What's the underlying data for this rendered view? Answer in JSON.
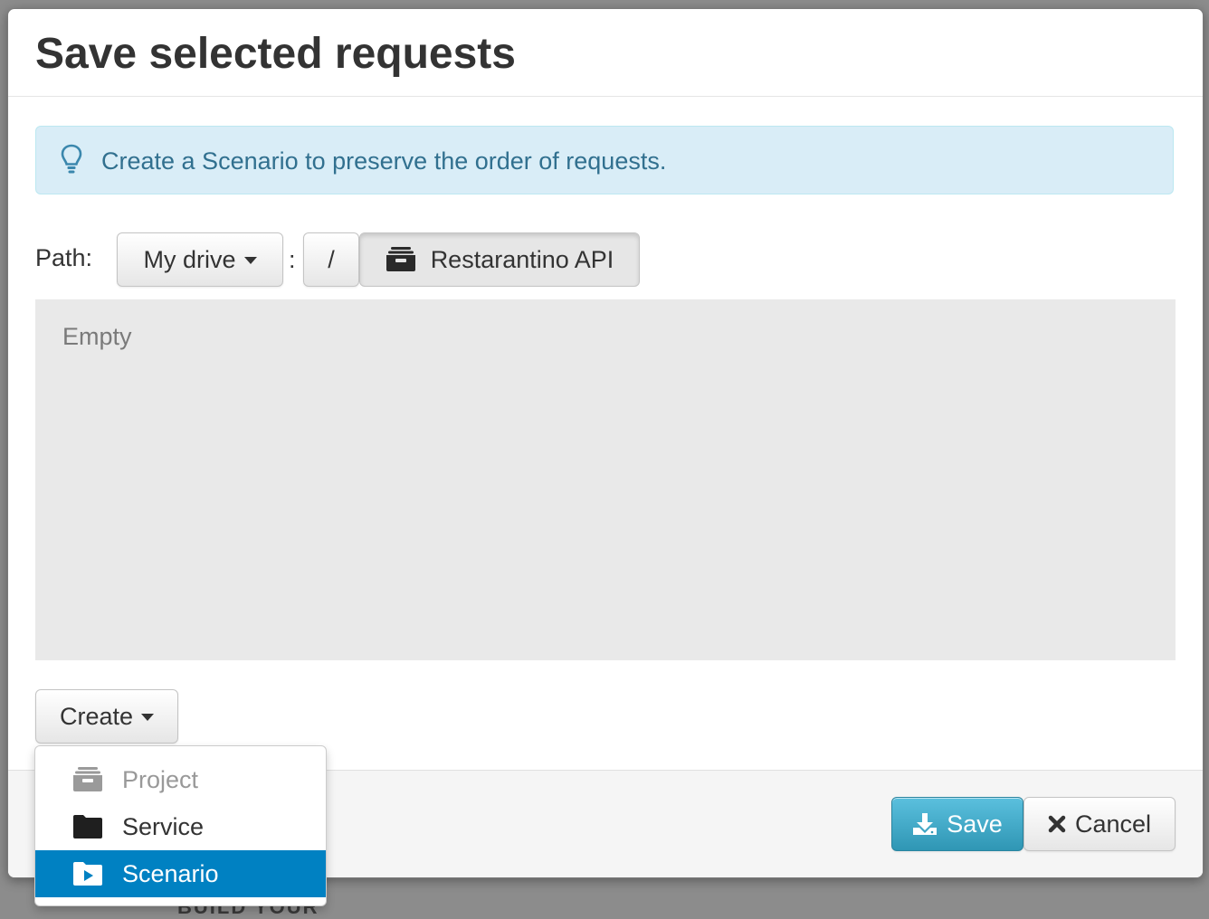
{
  "backdrop": {
    "partial_text": "BUILD YOUR"
  },
  "dialog": {
    "title": "Save selected requests",
    "info_message": "Create a Scenario to preserve the order of requests.",
    "path": {
      "label": "Path:",
      "drive_button": "My drive",
      "separator": ":",
      "root_button": "/",
      "project_button": "Restarantino API"
    },
    "browser": {
      "empty_text": "Empty"
    },
    "create_button": "Create",
    "create_menu": {
      "items": [
        {
          "label": "Project",
          "icon": "archive-icon",
          "state": "disabled"
        },
        {
          "label": "Service",
          "icon": "folder-icon",
          "state": "normal"
        },
        {
          "label": "Scenario",
          "icon": "play-folder-icon",
          "state": "active"
        }
      ]
    },
    "footer": {
      "save_button": "Save",
      "cancel_button": "Cancel"
    }
  },
  "colors": {
    "info_background": "#d9edf7",
    "info_text": "#31708f",
    "save_button": "#2f96b4",
    "menu_active": "#0081c2",
    "browser_background": "#e9e9e9"
  }
}
